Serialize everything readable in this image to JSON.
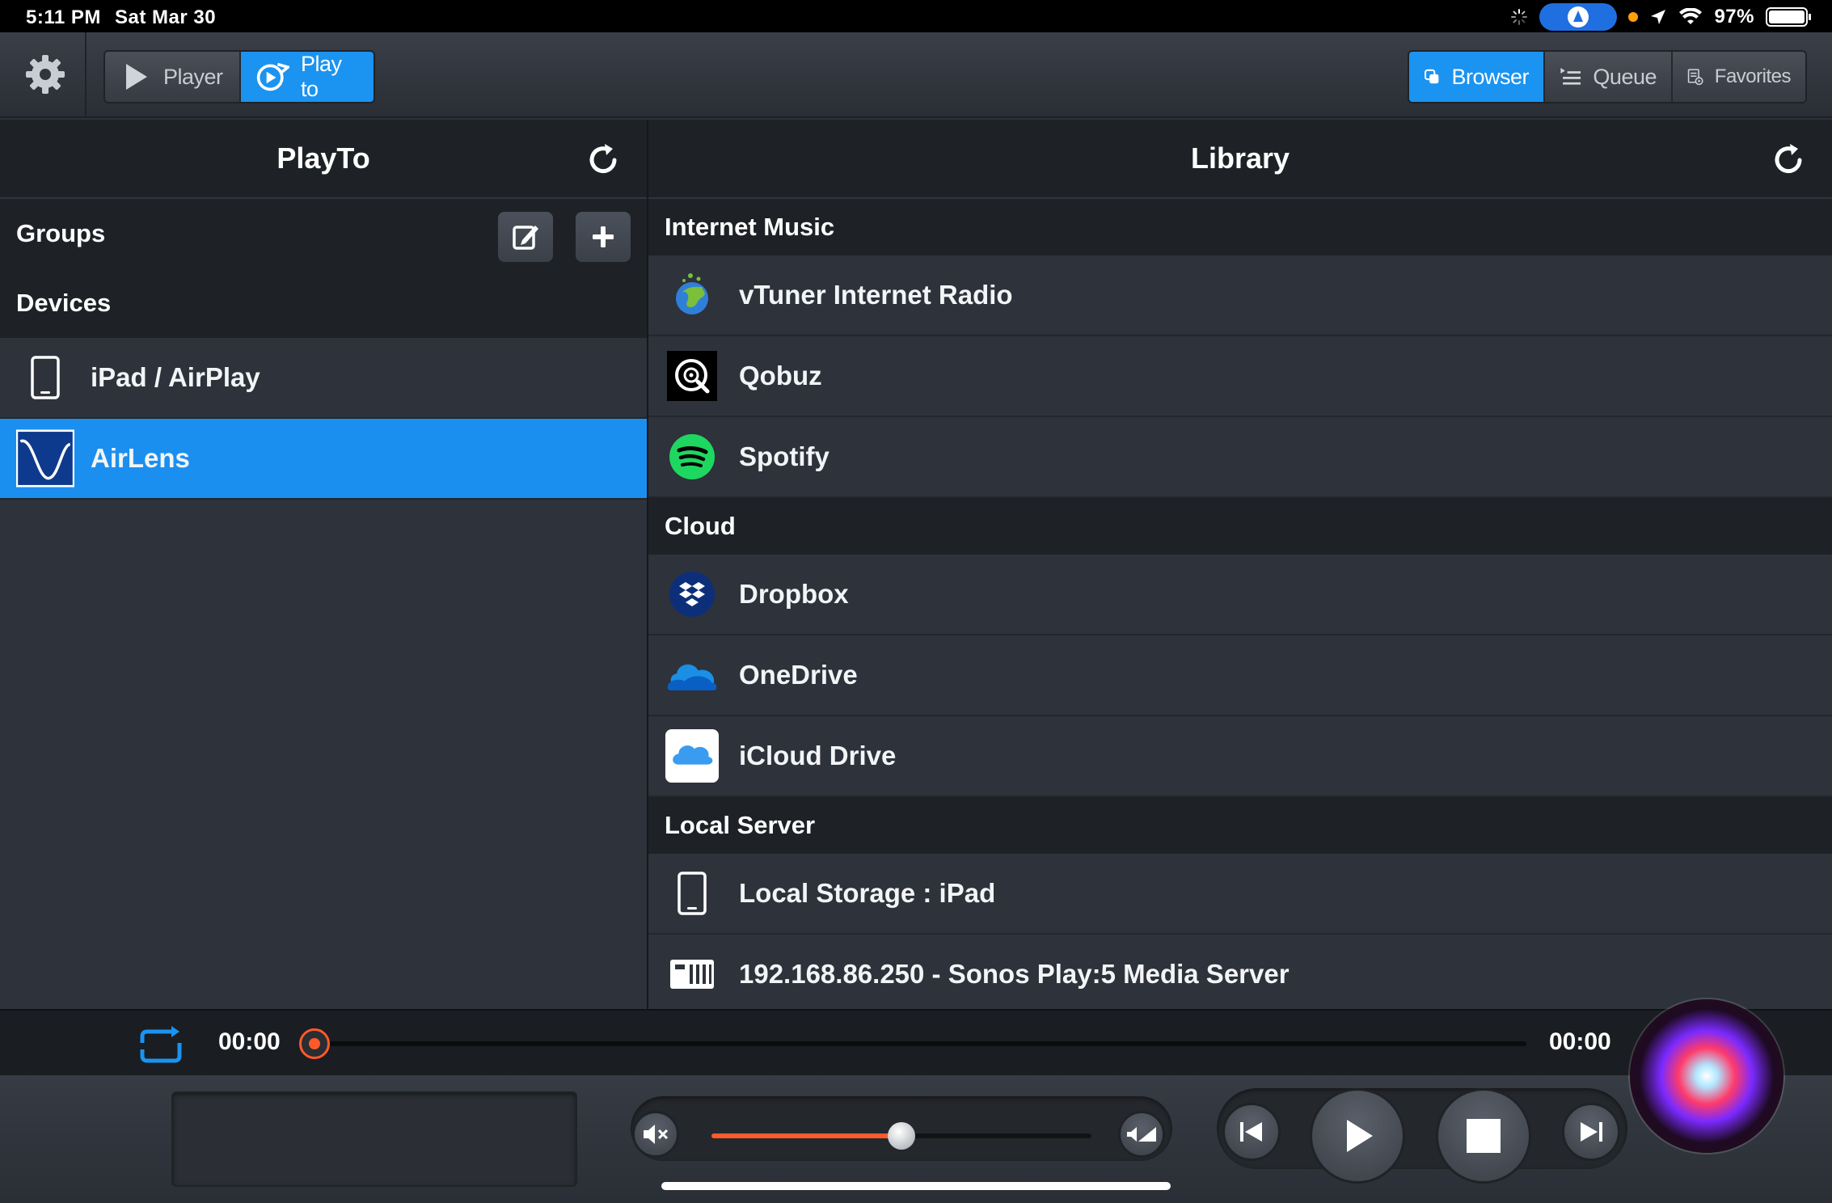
{
  "status_bar": {
    "time": "5:11 PM",
    "date": "Sat Mar 30",
    "battery": "97%"
  },
  "toolbar": {
    "player_label": "Player",
    "playto_label": "Play to",
    "browser_label": "Browser",
    "queue_label": "Queue",
    "favorites_label": "Favorites"
  },
  "left_panel": {
    "title": "PlayTo",
    "groups_label": "Groups",
    "devices_label": "Devices",
    "devices": [
      {
        "label": "iPad / AirPlay",
        "icon": "ipad-icon"
      },
      {
        "label": "AirLens",
        "icon": "airlens-wave-icon",
        "selected": true
      }
    ]
  },
  "right_panel": {
    "title": "Library",
    "sections": [
      {
        "title": "Internet Music",
        "items": [
          {
            "label": "vTuner Internet Radio",
            "icon": "vtuner-globe-icon"
          },
          {
            "label": "Qobuz",
            "icon": "qobuz-icon"
          },
          {
            "label": "Spotify",
            "icon": "spotify-icon"
          }
        ]
      },
      {
        "title": "Cloud",
        "items": [
          {
            "label": "Dropbox",
            "icon": "dropbox-icon"
          },
          {
            "label": "OneDrive",
            "icon": "onedrive-icon"
          },
          {
            "label": "iCloud Drive",
            "icon": "icloud-icon"
          }
        ]
      },
      {
        "title": "Local Server",
        "items": [
          {
            "label": "Local Storage : iPad",
            "icon": "ipad-icon"
          },
          {
            "label": "192.168.86.250 - Sonos Play:5 Media Server",
            "icon": "media-server-icon"
          }
        ]
      }
    ]
  },
  "playback": {
    "elapsed": "00:00",
    "remaining": "00:00",
    "progress_fraction": 0,
    "volume_fraction": 0.5
  },
  "colors": {
    "accent": "#1b93f0",
    "progress": "#ff5a2a"
  }
}
